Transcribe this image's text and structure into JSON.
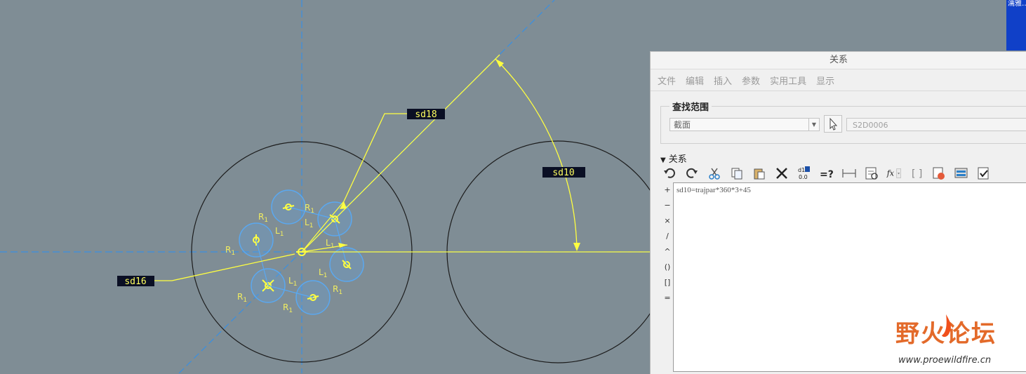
{
  "sketch": {
    "dimensions": {
      "sd18": "sd18",
      "sd10": "sd10",
      "sd16": "sd16"
    },
    "radius_label": "R",
    "length_label": "L",
    "subscript": "1",
    "colors": {
      "background": "#7f8d95",
      "dimension": "#ffff40",
      "centerline": "#3a8fe0",
      "circle": "#222222",
      "selected_circle": "#5aa8f0"
    }
  },
  "dialog": {
    "title": "关系",
    "menu": [
      "文件",
      "编辑",
      "插入",
      "参数",
      "实用工具",
      "显示"
    ],
    "scope": {
      "title": "查找范围",
      "selected": "截面",
      "field": "S2D0006"
    },
    "relations_header": "关系",
    "toolbar_icons": [
      "undo-icon",
      "redo-icon",
      "cut-icon",
      "copy-icon",
      "paste-icon",
      "delete-icon",
      "switch-dimensions-icon",
      "evaluate-icon",
      "show-dimension-icon",
      "sort-icon",
      "insert-function-icon",
      "insert-parameter-icon",
      "verify-icon",
      "import-icon",
      "export-icon"
    ],
    "operators": [
      "+",
      "−",
      "×",
      "/",
      "^",
      "()",
      "[]",
      "="
    ],
    "editor_text": "sd10=trajpar*360*3+45"
  },
  "watermark": {
    "brand": "野火论坛",
    "url": "www.proewildfire.cn"
  },
  "corner_text": "濡雅…"
}
